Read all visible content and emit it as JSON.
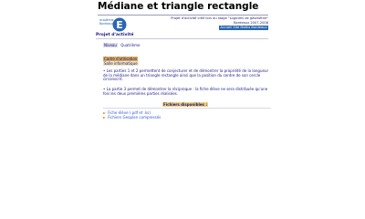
{
  "page": {
    "title": "Médiane et triangle rectangle",
    "subtitle_lines": [
      "Projet d'activité créé lors du stage \"Logiciels de géométrie\"",
      "Bordeaux 2007-2008"
    ],
    "home_button": "Accueil Site Maths Bordeaux",
    "logo_text": [
      "académie",
      "Bordeaux"
    ],
    "logo_letter": "E",
    "side_heading": "Projet d'activité"
  },
  "level": {
    "label": "Niveau",
    "value": "Quatrième"
  },
  "context": {
    "label": "Cadre d'utilisation",
    "value": "Salle informatique"
  },
  "paragraphs": [
    "• Les parties 1 et 2 permettent de conjecturer et de démontrer la propriété de la longueur de la médiane dans un triangle rectangle ainsi que la position du centre de son cercle circonscrit.",
    "• La partie 3 permet de démontrer la réciproque : la fiche élève ne sera distribuée qu'une fois les deux premières parties réalisées."
  ],
  "files": {
    "heading": "Fichiers disponibles :",
    "items": [
      {
        "label": "Fiche élève (.pdf et .ks)"
      },
      {
        "label": "Fichiers Geoplan compressés"
      }
    ]
  },
  "colors": {
    "brand_blue": "#2a66b3",
    "text_navy": "#1a1a80",
    "accent_orange": "#e07a18"
  }
}
